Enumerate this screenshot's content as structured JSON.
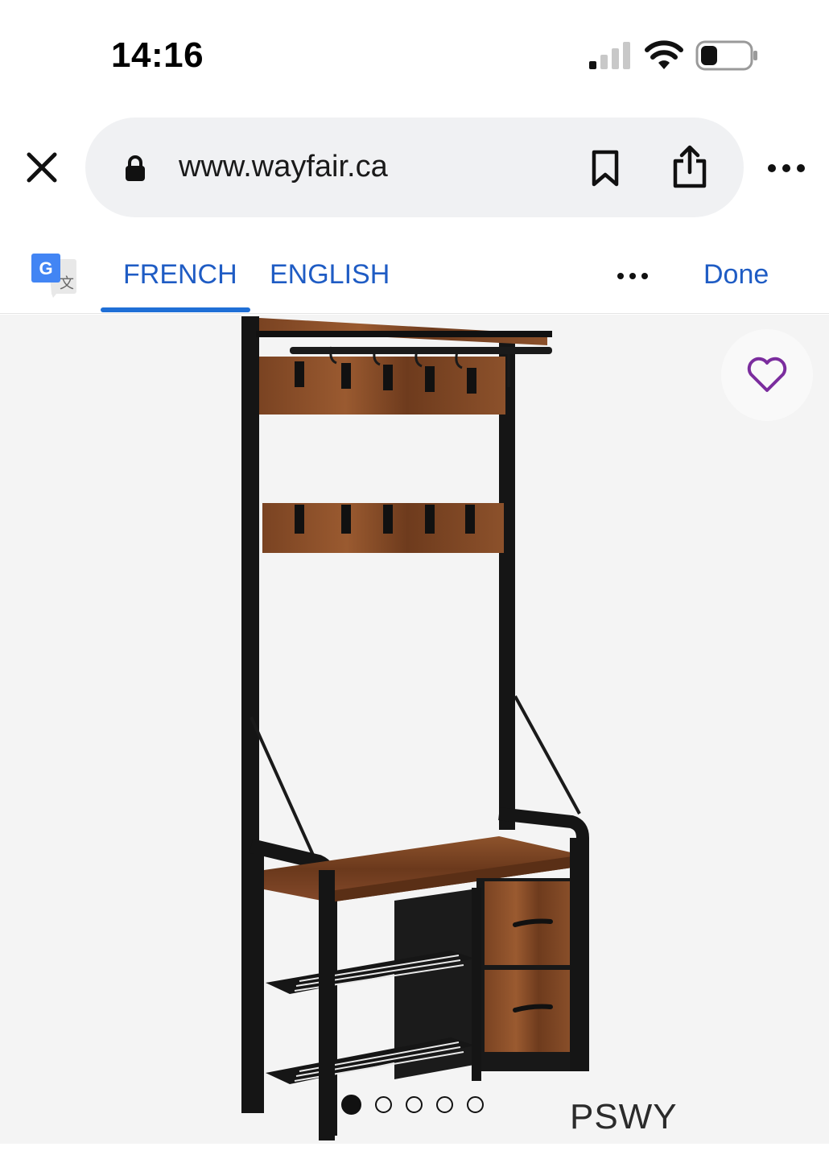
{
  "status_bar": {
    "time": "14:16",
    "icons": [
      "cellular-signal-icon",
      "wifi-icon",
      "battery-icon"
    ]
  },
  "browser": {
    "url": "www.wayfair.ca",
    "icons": [
      "close-icon",
      "lock-icon",
      "bookmark-icon",
      "share-icon",
      "more-icon"
    ]
  },
  "translate_bar": {
    "logo": "google-translate-icon",
    "tabs": [
      {
        "label": "FRENCH",
        "active": true
      },
      {
        "label": "ENGLISH",
        "active": false
      }
    ],
    "done_label": "Done",
    "accent_color": "#1f5cc4"
  },
  "gallery": {
    "image": "hall-tree-coat-rack-bench-with-shoe-storage",
    "favorite_icon": "heart-icon",
    "favorite_color": "#7b2d9e",
    "dot_count": 5,
    "active_dot": 1,
    "brand_watermark": "PSWY"
  }
}
